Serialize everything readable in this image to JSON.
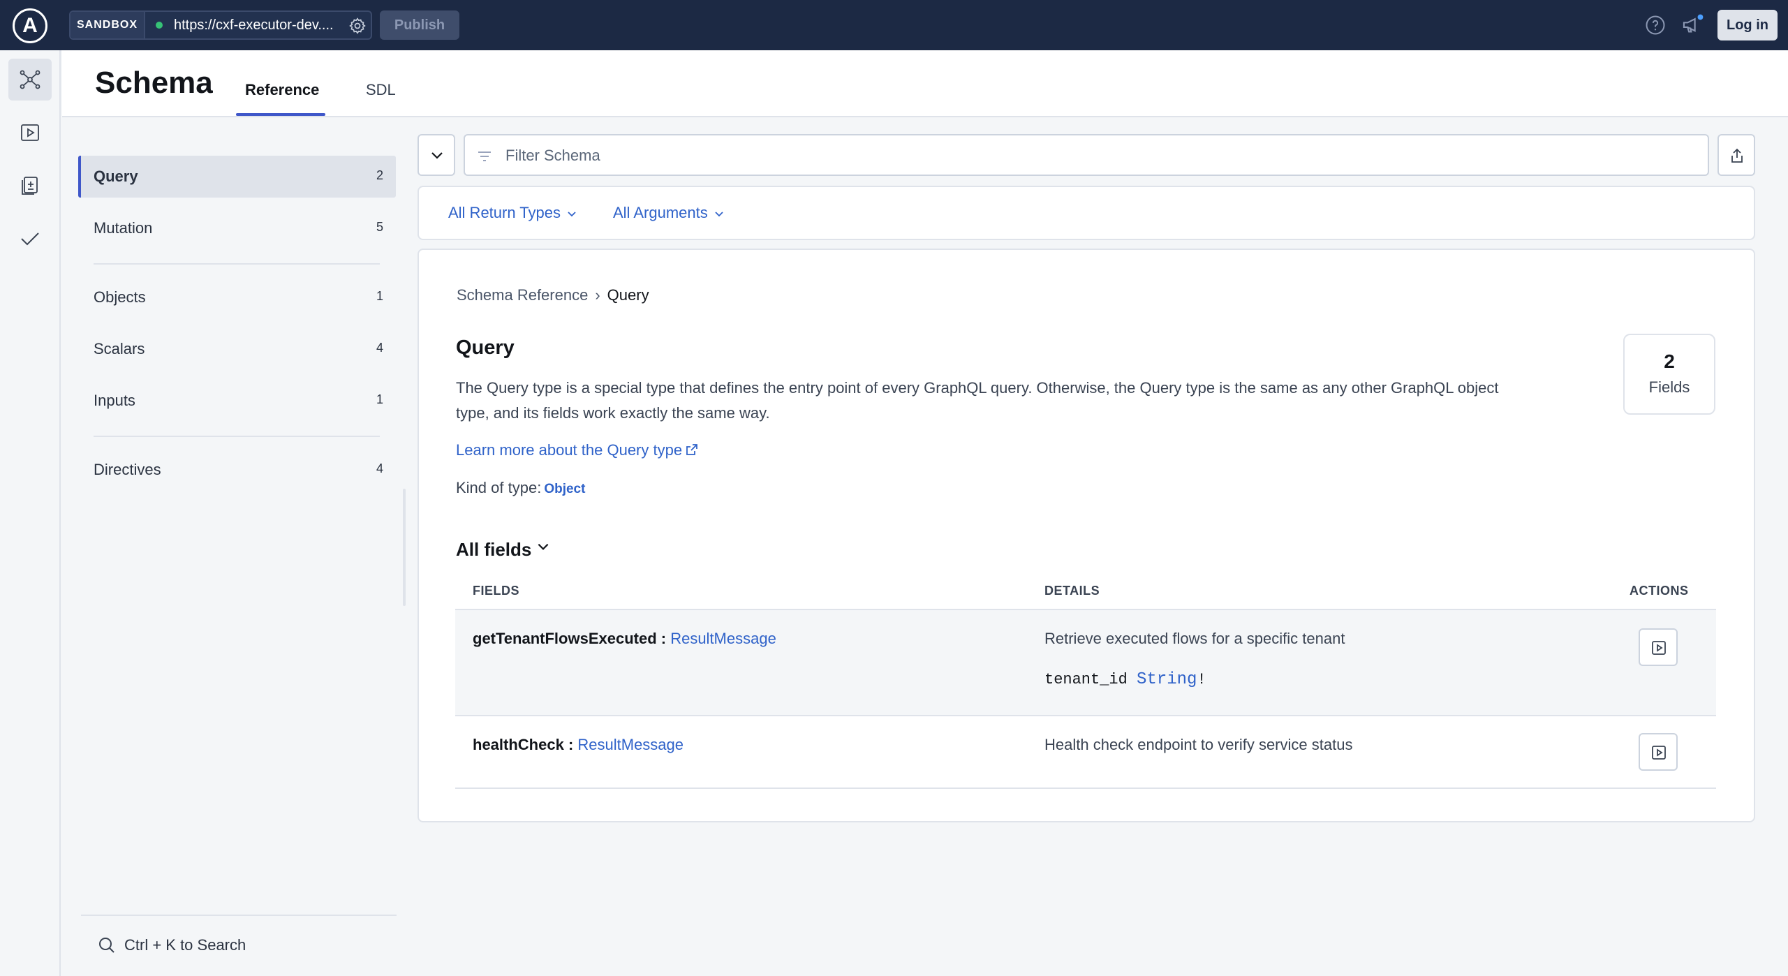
{
  "topbar": {
    "logo_letter": "A",
    "sandbox_label": "SANDBOX",
    "endpoint_url": "https://cxf-executor-dev....",
    "publish_label": "Publish",
    "login_label": "Log in"
  },
  "rail": {
    "items": [
      "schema-icon",
      "play-icon",
      "clipboard-icon",
      "check-icon"
    ],
    "active": "schema-icon"
  },
  "header": {
    "title": "Schema",
    "tabs": [
      {
        "label": "Reference",
        "active": true
      },
      {
        "label": "SDL",
        "active": false
      }
    ]
  },
  "sidebar": {
    "items": [
      {
        "label": "Query",
        "count": "2",
        "active": true
      },
      {
        "label": "Mutation",
        "count": "5"
      },
      {
        "label": "Objects",
        "count": "1"
      },
      {
        "label": "Scalars",
        "count": "4"
      },
      {
        "label": "Inputs",
        "count": "1"
      },
      {
        "label": "Directives",
        "count": "4"
      }
    ],
    "search_hint": "Ctrl + K to Search"
  },
  "filter": {
    "placeholder": "Filter Schema",
    "return_types_label": "All Return Types",
    "arguments_label": "All Arguments"
  },
  "content": {
    "breadcrumb": {
      "root": "Schema Reference",
      "separator": "›",
      "current": "Query"
    },
    "title": "Query",
    "description": "The Query type is a special type that defines the entry point of every GraphQL query. Otherwise, the Query type is the same as any other GraphQL object type, and its fields work exactly the same way.",
    "learn_more": "Learn more about the Query type",
    "kind_label": "Kind of type:",
    "kind_value": "Object",
    "stat": {
      "value": "2",
      "label": "Fields"
    },
    "all_fields_label": "All fields",
    "table": {
      "headers": [
        "FIELDS",
        "DETAILS",
        "ACTIONS"
      ],
      "rows": [
        {
          "name": "getTenantFlowsExecuted",
          "separator": " : ",
          "return_type": "ResultMessage",
          "description": "Retrieve executed flows for a specific tenant",
          "arg_name": "tenant_id",
          "arg_type": "String",
          "arg_suffix": "!"
        },
        {
          "name": "healthCheck",
          "separator": " : ",
          "return_type": "ResultMessage",
          "description": "Health check endpoint to verify service status"
        }
      ]
    }
  },
  "colors": {
    "topbar_bg": "#1c2944",
    "accent": "#3f57c9",
    "link": "#2f62c9",
    "status_ok": "#36c276"
  }
}
